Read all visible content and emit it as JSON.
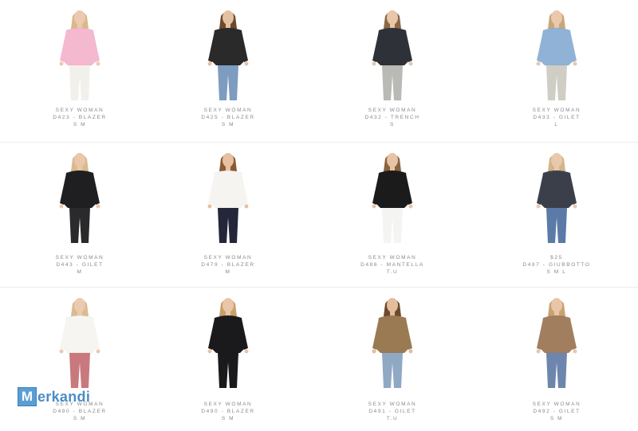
{
  "products": [
    {
      "brand": "SEXY WOMAN",
      "code": "D423 - BLAZER",
      "sizes": "S M",
      "colors": {
        "top": "#f4b8cf",
        "bottom": "#f2f0ea",
        "hair": "#d9b98a",
        "skin": "#ecc9b0"
      }
    },
    {
      "brand": "SEXY WOMAN",
      "code": "D425 - BLAZER",
      "sizes": "S M",
      "colors": {
        "top": "#2a2a2a",
        "bottom": "#7d9cc0",
        "hair": "#6b4a2f",
        "skin": "#e5c1a4"
      }
    },
    {
      "brand": "SEXY WOMAN",
      "code": "D432 - TRENCH",
      "sizes": "S",
      "colors": {
        "top": "#2e3238",
        "bottom": "#b9b9b5",
        "hair": "#8a6a45",
        "skin": "#e8c6aa"
      }
    },
    {
      "brand": "SEXY WOMAN",
      "code": "D433 - GILET",
      "sizes": "L",
      "colors": {
        "top": "#8fb2d6",
        "bottom": "#d0cdc4",
        "hair": "#c9a67a",
        "skin": "#eac8ad"
      }
    },
    {
      "brand": "SEXY WOMAN",
      "code": "D443 - GILET",
      "sizes": "M",
      "colors": {
        "top": "#1f1f22",
        "bottom": "#2a2a2d",
        "hair": "#d7bb8c",
        "skin": "#e9c7ab"
      }
    },
    {
      "brand": "SEXY WOMAN",
      "code": "D479 - BLAZER",
      "sizes": "M",
      "colors": {
        "top": "#f5f4f0",
        "bottom": "#24263a",
        "hair": "#8b5a35",
        "skin": "#e6c0a0"
      }
    },
    {
      "brand": "SEXY WOMAN",
      "code": "D486 - MANTELLA",
      "sizes": "T.U",
      "colors": {
        "top": "#1b1b1b",
        "bottom": "#f4f4f2",
        "hair": "#8a6440",
        "skin": "#e8c4a6"
      }
    },
    {
      "brand": "$25",
      "code": "D487 - GIUBBOTTO",
      "sizes": "S M L",
      "colors": {
        "top": "#3b3f4a",
        "bottom": "#5b7aa8",
        "hair": "#d3b48a",
        "skin": "#e9c8ac"
      }
    },
    {
      "brand": "SEXY WOMAN",
      "code": "D490 - BLAZER",
      "sizes": "S M",
      "colors": {
        "top": "#f6f5f2",
        "bottom": "#c9787e",
        "hair": "#d9bc8e",
        "skin": "#ebcab0"
      }
    },
    {
      "brand": "SEXY WOMAN",
      "code": "D490 - BLAZER",
      "sizes": "S M",
      "colors": {
        "top": "#1a1a1c",
        "bottom": "#1a1a1c",
        "hair": "#c8a06a",
        "skin": "#e9c6a8"
      }
    },
    {
      "brand": "SEXY WOMAN",
      "code": "D491 - GILET",
      "sizes": "T.U",
      "colors": {
        "top": "#9a7a52",
        "bottom": "#8fa8c4",
        "hair": "#6e4a2e",
        "skin": "#e3bd9c"
      }
    },
    {
      "brand": "SEXY WOMAN",
      "code": "D492 - GILET",
      "sizes": "S M",
      "colors": {
        "top": "#a07e5e",
        "bottom": "#6d86ad",
        "hair": "#c9a272",
        "skin": "#e9c6a8"
      }
    }
  ],
  "watermark": {
    "initial": "M",
    "rest": "erkandi"
  }
}
